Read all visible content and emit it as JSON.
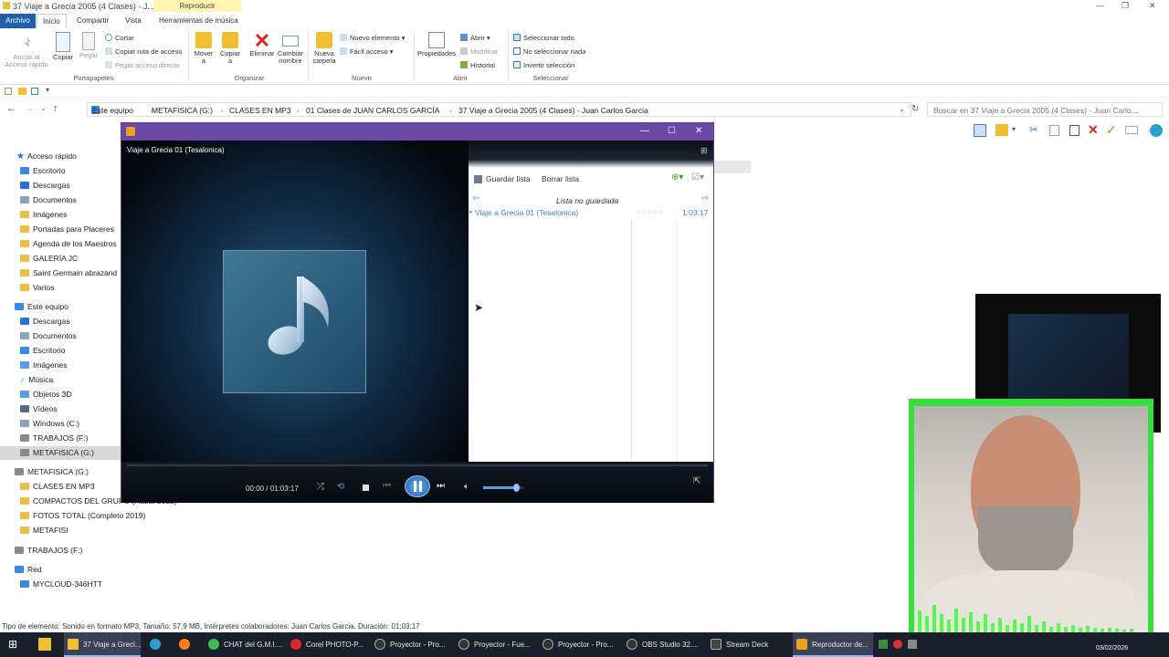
{
  "window_title": "37 Viaje a Grecia 2005 (4 Clases) - J...",
  "contextual_tab": "Reproducir",
  "tabs": [
    "Archivo",
    "Inicio",
    "Compartir",
    "Vista",
    "Herramientas de música"
  ],
  "ribbon": {
    "pin": "Anclar al\nAcceso rápido",
    "copy": "Copiar",
    "paste": "Pegar",
    "cut": "Cortar",
    "copy_path": "Copiar ruta de acceso",
    "paste_shortcut": "Pegar acceso directo",
    "move_to": "Mover\na",
    "copy_to": "Copiar\na",
    "delete": "Eliminar",
    "rename": "Cambiar\nnombre",
    "new_folder": "Nueva\ncarpeta",
    "new_item": "Nuevo elemento",
    "easy_access": "Fácil acceso",
    "properties": "Propiedades",
    "open": "Abrir",
    "edit": "Modificar",
    "history": "Historial",
    "select_all": "Seleccionar todo",
    "select_none": "No seleccionar nada",
    "invert_selection": "Invertir selección",
    "groups": [
      "Portapapeles",
      "Organizar",
      "Nuevo",
      "Abrir",
      "Seleccionar"
    ]
  },
  "address": {
    "crumbs": [
      "Este equipo",
      "METAFISICA (G:)",
      "CLASES EN MP3",
      "01 Clases de JUAN CARLOS GARCÍA",
      "37 Viaje a Grecia 2005 (4 Clases) - Juan Carlos Garcia"
    ],
    "search_placeholder": "Buscar en 37 Viaje a Grecia 2005 (4 Clases) - Juan Carlo..."
  },
  "nav": [
    {
      "label": "Acceso rápido",
      "icon": "star-icon",
      "color": "#2a6fd6"
    },
    {
      "label": "Escritorio",
      "icon": "desktop-icon",
      "color": "#3a88e0"
    },
    {
      "label": "Descargas",
      "icon": "download-icon",
      "color": "#2a6fd6"
    },
    {
      "label": "Documentos",
      "icon": "documents-icon",
      "color": "#8da3b8"
    },
    {
      "label": "Imágenes",
      "icon": "folder-icon",
      "color": "#e8c04a"
    },
    {
      "label": "Portadas para Placeres",
      "icon": "folder-icon",
      "color": "#e8c04a"
    },
    {
      "label": "Agenda de los Maestros",
      "icon": "folder-icon",
      "color": "#e8c04a"
    },
    {
      "label": "GALERÍA JC",
      "icon": "folder-icon",
      "color": "#e8c04a"
    },
    {
      "label": "Saint Germain abrazand",
      "icon": "folder-icon",
      "color": "#e8c04a"
    },
    {
      "label": "Varios",
      "icon": "folder-icon",
      "color": "#e8c04a"
    },
    {
      "label": "Este equipo",
      "icon": "pc-icon",
      "color": "#3a88e0"
    },
    {
      "label": "Descargas",
      "icon": "download-icon",
      "color": "#2a6fd6"
    },
    {
      "label": "Documentos",
      "icon": "documents-icon",
      "color": "#8da3b8"
    },
    {
      "label": "Escritorio",
      "icon": "desktop-icon",
      "color": "#3a88e0"
    },
    {
      "label": "Imágenes",
      "icon": "pictures-icon",
      "color": "#5aa0e0"
    },
    {
      "label": "Música",
      "icon": "music-icon",
      "color": "#3a88e0"
    },
    {
      "label": "Objetos 3D",
      "icon": "objects3d-icon",
      "color": "#5aa0e0"
    },
    {
      "label": "Vídeos",
      "icon": "videos-icon",
      "color": "#5a6a80"
    },
    {
      "label": "Windows (C:)",
      "icon": "drive-icon",
      "color": "#8aa0b5"
    },
    {
      "label": "TRABAJOS (F:)",
      "icon": "drive-icon",
      "color": "#8a8a8a"
    },
    {
      "label": "METAFISICA (G:)",
      "icon": "drive-icon",
      "color": "#8a8a8a"
    },
    {
      "label": "METAFISICA (G:)",
      "icon": "drive-icon",
      "color": "#8a8a8a"
    },
    {
      "label": "CLASES EN MP3",
      "icon": "folder-icon",
      "color": "#e8c04a"
    },
    {
      "label": "COMPACTOS DEL GRUPO (Hasta 2022)",
      "icon": "folder-icon",
      "color": "#e8c04a"
    },
    {
      "label": "FOTOS TOTAL (Completo 2019)",
      "icon": "folder-icon",
      "color": "#e8c04a"
    },
    {
      "label": "METAFISI",
      "icon": "folder-icon",
      "color": "#e8c04a"
    },
    {
      "label": "TRABAJOS (F:)",
      "icon": "drive-icon",
      "color": "#8a8a8a"
    },
    {
      "label": "Red",
      "icon": "network-icon",
      "color": "#3a88e0"
    },
    {
      "label": "MYCLOUD-346HTT",
      "icon": "network-drive-icon",
      "color": "#3a88e0"
    }
  ],
  "status_text": "Tipo de elemento: Sonido en formato MP3, Tamaño: 57,9 MB, Intérpretes colaboradores: Juan Carlos Garcia, Duración: 01:03:17",
  "player": {
    "now_playing": "Viaje a Grecia 01 (Tesalonica)",
    "save_list": "Guardar lista",
    "clear_list": "Borrar lista",
    "list_title": "Lista no guardada",
    "tracks": [
      {
        "title": "Viaje a Grecia 01 (Tesalonica)",
        "duration": "1:03:17"
      }
    ],
    "time": "00:00 / 01:03:17",
    "progress": 0,
    "volume": 0.85
  },
  "taskbar": [
    {
      "label": "37 Viaje a Greci...",
      "icon": "explorer-icon",
      "color": "#f0c030"
    },
    {
      "label": "",
      "icon": "edge-icon",
      "color": "#2d9ad6"
    },
    {
      "label": "",
      "icon": "firefox-icon",
      "color": "#ff7a20"
    },
    {
      "label": "CHAT del G.M.I....",
      "icon": "chrome-icon",
      "color": "#3cba54"
    },
    {
      "label": "Corel PHOTO-P...",
      "icon": "corel-icon",
      "color": "#d62b2b"
    },
    {
      "label": "Proyector - Pro...",
      "icon": "obs-icon",
      "color": "#333"
    },
    {
      "label": "Proyector - Fue...",
      "icon": "obs-icon",
      "color": "#333"
    },
    {
      "label": "Proyector - Pro...",
      "icon": "obs-icon",
      "color": "#333"
    },
    {
      "label": "OBS Studio 32....",
      "icon": "obs-icon",
      "color": "#333"
    },
    {
      "label": "Stream Deck",
      "icon": "streamdeck-icon",
      "color": "#444"
    },
    {
      "label": "Reproductor de...",
      "icon": "wmp-icon",
      "color": "#f0a020"
    }
  ],
  "clock_date": "03/02/2026"
}
